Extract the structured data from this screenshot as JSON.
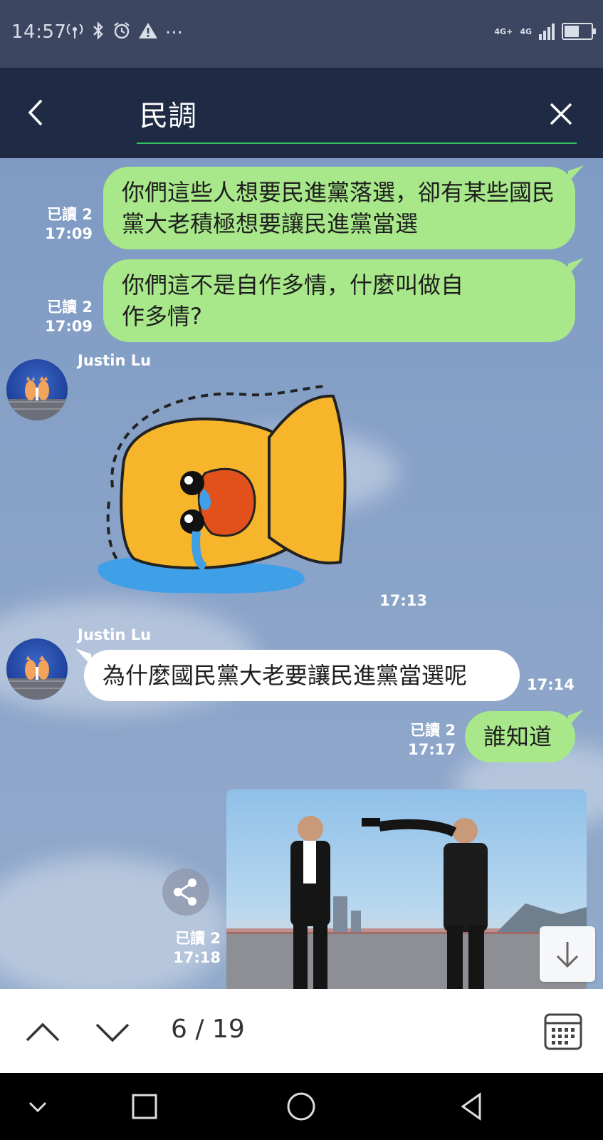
{
  "status_bar": {
    "time": "14:57",
    "left_icons": [
      "hotspot-icon",
      "bluetooth-icon",
      "alarm-icon",
      "warning-icon",
      "more-dots"
    ],
    "overflow": "...",
    "net1": "4G+",
    "net2": "4G",
    "battery_level": 0.55
  },
  "search": {
    "query": "民調",
    "accent_color": "#33c25c"
  },
  "messages": {
    "m1": {
      "text": "你們這些人想要民進黨落選，卻有某些國民黨大老積極想要讓民進黨當選",
      "read": "已讀 2",
      "time": "17:09"
    },
    "m2": {
      "text": "你們這不是自作多情，什麼叫做自作多情?",
      "read": "已讀 2",
      "time": "17:09"
    },
    "m3": {
      "sender": "Justin Lu",
      "sticker": "crying-yellow-fish-sticker",
      "time": "17:13"
    },
    "m4": {
      "sender": "Justin Lu",
      "text": "為什麼國民黨大老要讓民進黨當選呢",
      "time": "17:14"
    },
    "m5": {
      "text": "誰知道",
      "read": "已讀 2",
      "time": "17:17"
    },
    "m6": {
      "image": "two-men-rooftop-photo",
      "read": "已讀 2",
      "time": "17:18"
    }
  },
  "find_bar": {
    "counter": "6 / 19"
  },
  "colors": {
    "outgoing_bubble": "#a8e88a",
    "incoming_bubble": "#ffffff",
    "header": "#1f2b45",
    "status_bar": "#3c4660"
  }
}
